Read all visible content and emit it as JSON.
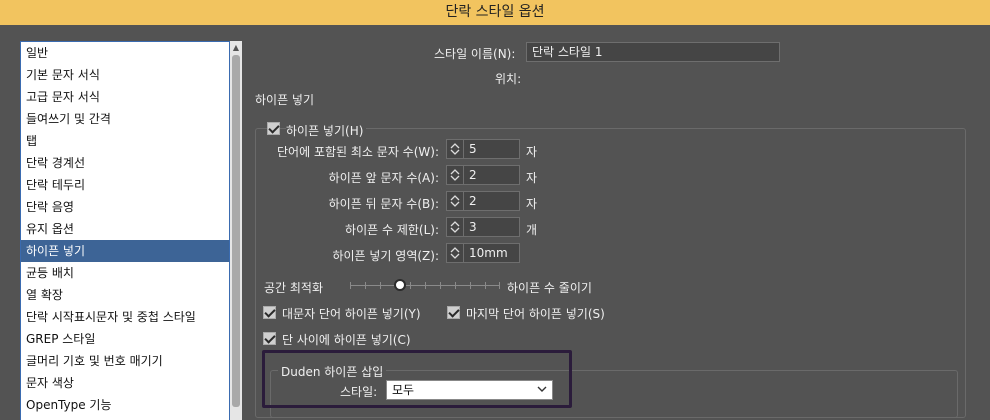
{
  "window": {
    "title": "단락 스타일 옵션"
  },
  "sidebar": {
    "items": [
      {
        "label": "일반"
      },
      {
        "label": "기본 문자 서식"
      },
      {
        "label": "고급 문자 서식"
      },
      {
        "label": "들여쓰기 및 간격"
      },
      {
        "label": "탭"
      },
      {
        "label": "단락 경계선"
      },
      {
        "label": "단락 테두리"
      },
      {
        "label": "단락 음영"
      },
      {
        "label": "유지 옵션"
      },
      {
        "label": "하이픈 넣기",
        "selected": true
      },
      {
        "label": "균등 배치"
      },
      {
        "label": "열 확장"
      },
      {
        "label": "단락 시작표시문자 및 중첩 스타일"
      },
      {
        "label": "GREP 스타일"
      },
      {
        "label": "글머리 기호 및 번호 매기기"
      },
      {
        "label": "문자 색상"
      },
      {
        "label": "OpenType 기능"
      }
    ]
  },
  "header": {
    "style_name_label": "스타일 이름(N):",
    "style_name_value": "단락 스타일 1",
    "location_label": "위치:",
    "section_title": "하이픈 넣기"
  },
  "hyphenation": {
    "enable_label": "하이픈 넣기(H)",
    "enable_checked": true,
    "fields": [
      {
        "label": "단어에 포함된 최소 문자 수(W):",
        "value": "5",
        "unit": "자"
      },
      {
        "label": "하이픈 앞 문자 수(A):",
        "value": "2",
        "unit": "자"
      },
      {
        "label": "하이픈 뒤 문자 수(B):",
        "value": "2",
        "unit": "자"
      },
      {
        "label": "하이픈 수 제한(L):",
        "value": "3",
        "unit": "개"
      },
      {
        "label": "하이픈 넣기 영역(Z):",
        "value": "10mm",
        "unit": ""
      }
    ],
    "slider": {
      "left_label": "공간 최적화",
      "right_label": "하이픈 수 줄이기",
      "position_fraction": 0.33
    },
    "options": {
      "caps_label": "대문자 단어 하이픈 넣기(Y)",
      "caps_checked": true,
      "last_word_label": "마지막 단어 하이픈 넣기(S)",
      "last_word_checked": true,
      "across_columns_label": "단 사이에 하이픈 넣기(C)",
      "across_columns_checked": true
    }
  },
  "duden": {
    "group_title": "Duden 하이픈 삽입",
    "style_label": "스타일:",
    "style_value": "모두"
  },
  "colors": {
    "titlebar": "#f2c45f",
    "selected_item": "#3d6496",
    "panel_background": "#535353"
  }
}
